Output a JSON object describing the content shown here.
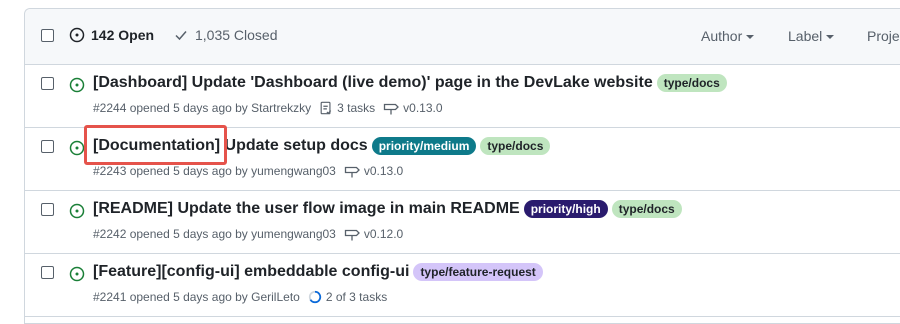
{
  "header": {
    "open_label": "142 Open",
    "closed_label": "1,035 Closed",
    "filters": [
      "Author",
      "Label",
      "Proje"
    ]
  },
  "issues": [
    {
      "title": "[Dashboard] Update 'Dashboard (live demo)' page in the DevLake website",
      "labels": [
        {
          "text": "type/docs",
          "bg": "#bfe5bf",
          "fg": "#1f2328"
        }
      ],
      "meta": "#2244 opened 5 days ago by Startrekzky",
      "tasks": "3 tasks",
      "milestone": "v0.13.0"
    },
    {
      "title": "[Documentation] Update setup docs",
      "labels": [
        {
          "text": "priority/medium",
          "bg": "#0e7a8a",
          "fg": "#ffffff"
        },
        {
          "text": "type/docs",
          "bg": "#bfe5bf",
          "fg": "#1f2328"
        }
      ],
      "meta": "#2243 opened 5 days ago by yumengwang03",
      "milestone": "v0.13.0"
    },
    {
      "title": "[README] Update the user flow image in main README",
      "labels": [
        {
          "text": "priority/high",
          "bg": "#2a1b6e",
          "fg": "#ffffff"
        },
        {
          "text": "type/docs",
          "bg": "#bfe5bf",
          "fg": "#1f2328"
        }
      ],
      "meta": "#2242 opened 5 days ago by yumengwang03",
      "milestone": "v0.12.0"
    },
    {
      "title": "[Feature][config-ui] embeddable config-ui",
      "labels": [
        {
          "text": "type/feature-request",
          "bg": "#d4c5f9",
          "fg": "#1f2328"
        }
      ],
      "meta": "#2241 opened 5 days ago by GerilLeto",
      "progress": "2 of 3 tasks"
    }
  ],
  "colors": {
    "open_green": "#1a7f37",
    "muted": "#57606a",
    "highlight": "#e5534b",
    "progress_blue": "#0969da"
  }
}
